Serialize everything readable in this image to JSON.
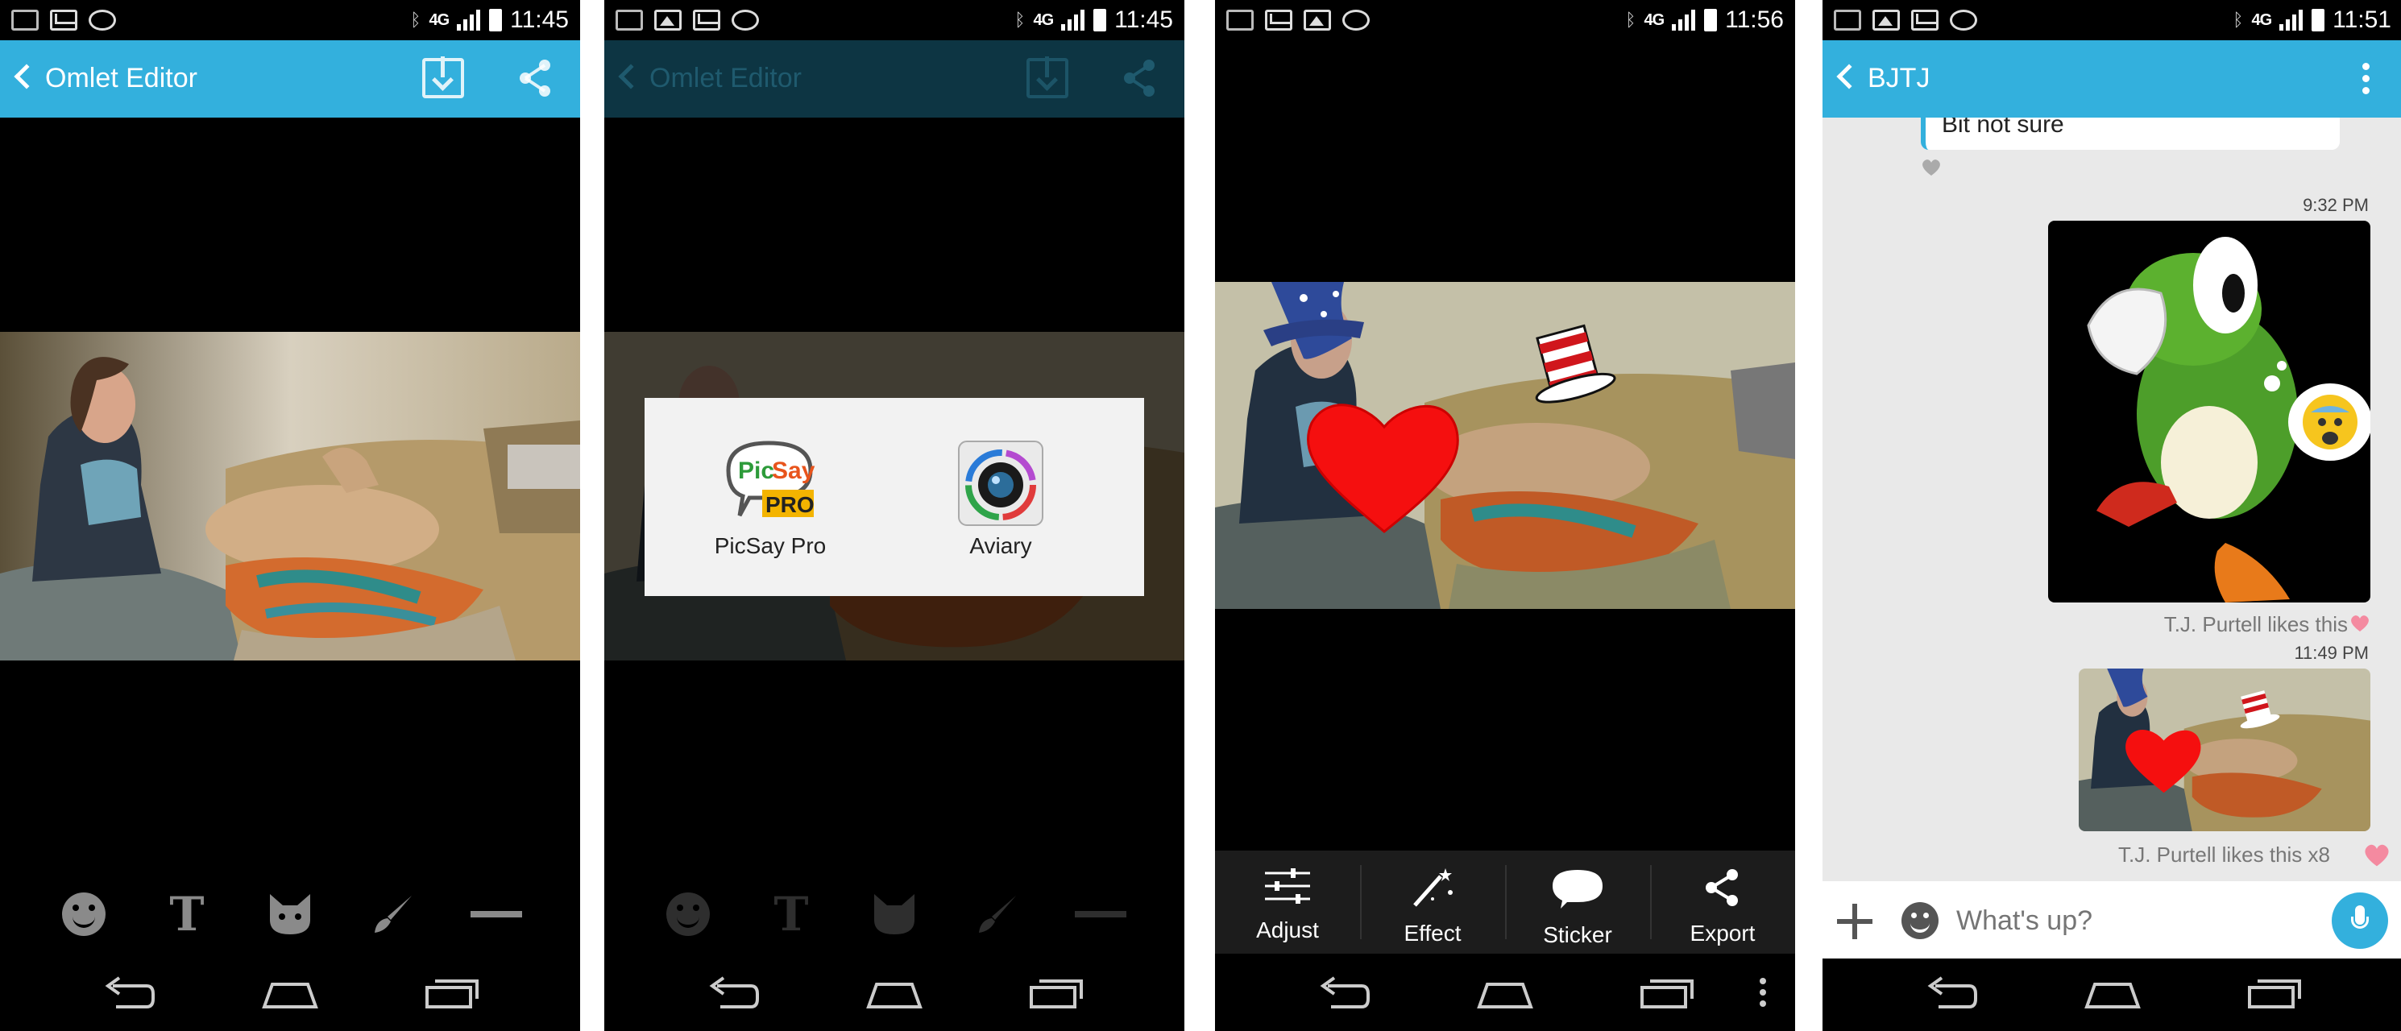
{
  "status_bars": [
    {
      "network": "4G",
      "time": "11:45"
    },
    {
      "network": "4G",
      "time": "11:45"
    },
    {
      "network": "4G",
      "time": "11:56"
    },
    {
      "network": "4G",
      "time": "11:51"
    }
  ],
  "screen1": {
    "title": "Omlet Editor",
    "tools": [
      "sticker-face",
      "text",
      "cat-mask",
      "brush",
      "menu"
    ],
    "text_tool_label": "T"
  },
  "screen2": {
    "title": "Omlet Editor",
    "chooser": {
      "items": [
        {
          "label": "PicSay Pro",
          "logo_text_1": "Pic",
          "logo_text_2": "Say",
          "logo_text_3": "PRO"
        },
        {
          "label": "Aviary"
        }
      ]
    },
    "text_tool_label": "T"
  },
  "screen3": {
    "toolbar": [
      {
        "label": "Adjust",
        "icon": "sliders-icon"
      },
      {
        "label": "Effect",
        "icon": "magic-wand-icon"
      },
      {
        "label": "Sticker",
        "icon": "speech-bubble-icon"
      },
      {
        "label": "Export",
        "icon": "share-icon"
      }
    ]
  },
  "screen4": {
    "title": "BJTJ",
    "messages": {
      "incoming_text": "Bit not sure",
      "time_1": "9:32 PM",
      "likes_1": "T.J. Purtell likes this",
      "time_2": "11:49 PM",
      "likes_2": "T.J. Purtell likes this x8"
    },
    "input_placeholder": "What's up?"
  },
  "colors": {
    "app_bar": "#33b0dd",
    "heart_like": "#f48aa0",
    "chat_background": "#e9e9e9"
  }
}
